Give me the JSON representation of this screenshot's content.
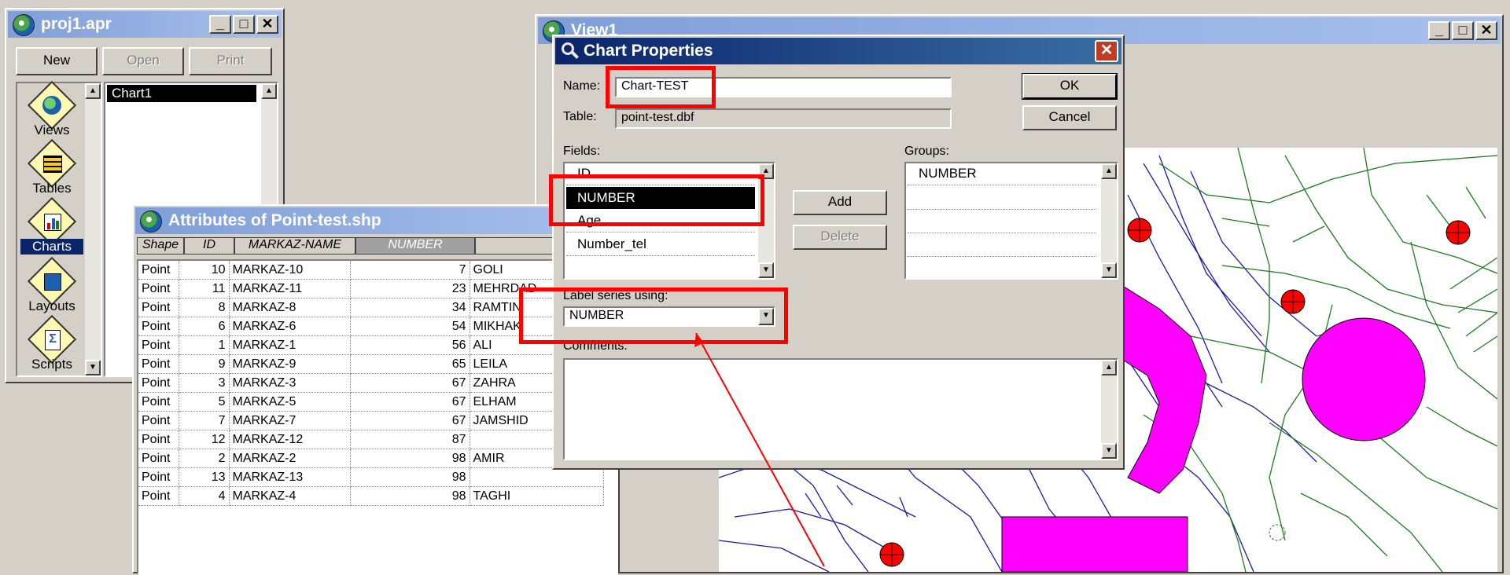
{
  "project_window": {
    "title": "proj1.apr",
    "buttons": [
      "New",
      "Open",
      "Print"
    ],
    "doc_types": [
      "Views",
      "Tables",
      "Charts",
      "Layouts",
      "Scripts"
    ],
    "selected_type": "Charts",
    "documents": [
      "Chart1"
    ]
  },
  "view_window": {
    "title": "View1"
  },
  "attributes_window": {
    "title": "Attributes of Point-test.shp",
    "columns": [
      "Shape",
      "ID",
      "MARKAZ-NAME",
      "NUMBER"
    ],
    "rows": [
      [
        "Point",
        "10",
        "MARKAZ-10",
        "7",
        "GOLI"
      ],
      [
        "Point",
        "11",
        "MARKAZ-11",
        "23",
        "MEHRDAD"
      ],
      [
        "Point",
        "8",
        "MARKAZ-8",
        "34",
        "RAMTIN"
      ],
      [
        "Point",
        "6",
        "MARKAZ-6",
        "54",
        "MIKHAK"
      ],
      [
        "Point",
        "1",
        "MARKAZ-1",
        "56",
        "ALI"
      ],
      [
        "Point",
        "9",
        "MARKAZ-9",
        "65",
        "LEILA"
      ],
      [
        "Point",
        "3",
        "MARKAZ-3",
        "67",
        "ZAHRA"
      ],
      [
        "Point",
        "5",
        "MARKAZ-5",
        "67",
        "ELHAM"
      ],
      [
        "Point",
        "7",
        "MARKAZ-7",
        "67",
        "JAMSHID"
      ],
      [
        "Point",
        "12",
        "MARKAZ-12",
        "87",
        ""
      ],
      [
        "Point",
        "2",
        "MARKAZ-2",
        "98",
        "AMIR"
      ],
      [
        "Point",
        "13",
        "MARKAZ-13",
        "98",
        ""
      ],
      [
        "Point",
        "4",
        "MARKAZ-4",
        "98",
        "TAGHI"
      ]
    ]
  },
  "chart_properties": {
    "title": "Chart Properties",
    "name_label": "Name:",
    "name_value": "Chart-TEST",
    "table_label": "Table:",
    "table_value": "point-test.dbf",
    "ok": "OK",
    "cancel": "Cancel",
    "fields_label": "Fields:",
    "fields": [
      "ID",
      "NUMBER",
      "Age",
      "Number_tel"
    ],
    "selected_field": "NUMBER",
    "add": "Add",
    "delete": "Delete",
    "groups_label": "Groups:",
    "groups": [
      "NUMBER"
    ],
    "label_series_label": "Label series using:",
    "label_series_value": "NUMBER",
    "comments_label": "Comments:",
    "comments_value": ""
  },
  "colors": {
    "highlight_red": "#ff0000",
    "magenta": "#ff00ff",
    "roads_blue": "#1a1aa8",
    "roads_green": "#1d7a1d"
  }
}
